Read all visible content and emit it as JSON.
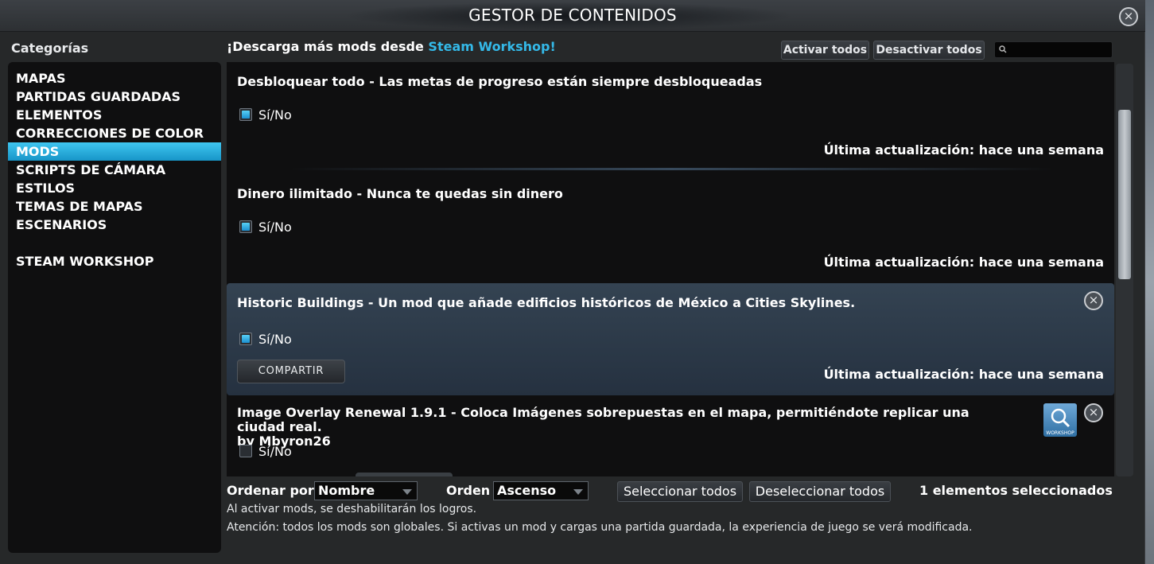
{
  "window": {
    "title": "GESTOR DE CONTENIDOS",
    "close_icon": "×"
  },
  "sidebar": {
    "heading": "Categorías",
    "items": [
      {
        "label": "MAPAS",
        "active": false
      },
      {
        "label": "PARTIDAS GUARDADAS",
        "active": false
      },
      {
        "label": "ELEMENTOS",
        "active": false
      },
      {
        "label": "CORRECCIONES DE COLOR",
        "active": false
      },
      {
        "label": "MODS",
        "active": true
      },
      {
        "label": "SCRIPTS DE CÁMARA",
        "active": false
      },
      {
        "label": "ESTILOS",
        "active": false
      },
      {
        "label": "TEMAS DE MAPAS",
        "active": false
      },
      {
        "label": "ESCENARIOS",
        "active": false
      },
      {
        "label": "STEAM WORKSHOP",
        "active": false
      }
    ]
  },
  "header": {
    "download_prefix": "¡Descarga más mods desde ",
    "download_link": "Steam Workshop!",
    "enable_all": "Activar todos",
    "disable_all": "Desactivar todos",
    "search_placeholder": ""
  },
  "mods": [
    {
      "title": "Desbloquear todo - Las metas de progreso están siempre desbloqueadas",
      "toggle_label": "Sí/No",
      "enabled": true,
      "updated": "Última actualización: hace una semana"
    },
    {
      "title": "Dinero ilimitado - Nunca te quedas sin dinero",
      "toggle_label": "Sí/No",
      "enabled": true,
      "updated": "Última actualización: hace una semana"
    },
    {
      "title": "Historic Buildings - Un mod que añade edificios históricos de México a Cities Skylines.",
      "toggle_label": "Sí/No",
      "enabled": true,
      "share_label": "COMPARTIR",
      "updated": "Última actualización: hace una semana",
      "remove_icon": "×"
    },
    {
      "title": "Image Overlay Renewal 1.9.1 - Coloca Imágenes sobrepuestas en el mapa, permitiéndote replicar una ciudad real.",
      "author": "by Mbyron26",
      "toggle_label": "Sí/No",
      "enabled": false,
      "workshop_badge": "WORKSHOP",
      "remove_icon": "×"
    }
  ],
  "footer": {
    "sort_label": "Ordenar por",
    "sort_value": "Nombre",
    "order_label": "Orden",
    "order_value": "Ascenso",
    "select_all": "Seleccionar todos",
    "deselect_all": "Deseleccionar todos",
    "selected_count": "1 elementos seleccionados",
    "note_achievements": "Al activar mods, se deshabilitarán los logros.",
    "note_global": "Atención: todos los mods son globales. Si activas un mod y cargas una partida guardada, la experiencia de juego se verá modificada."
  },
  "colors": {
    "accent": "#34b9e8",
    "active_item": "#1fa5d8",
    "panel": "#0f0f10",
    "window": "#262829"
  },
  "icons": [
    "close-icon",
    "search-icon",
    "checkbox-icon",
    "workshop-search-icon",
    "remove-icon",
    "dropdown-arrow-icon"
  ]
}
